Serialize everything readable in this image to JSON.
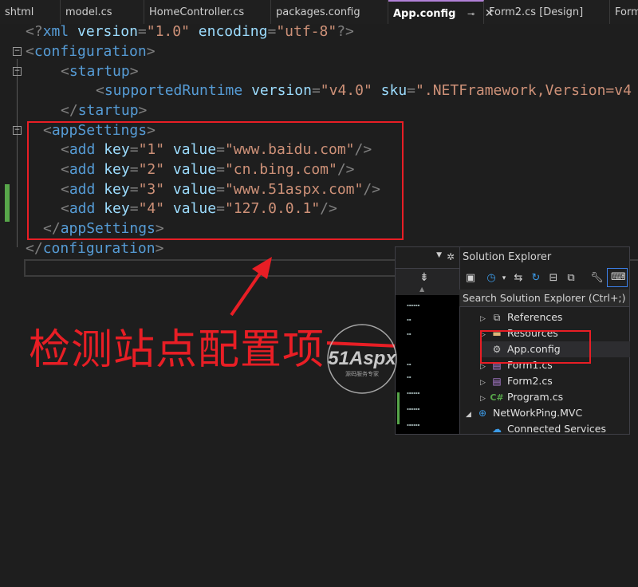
{
  "tabs": [
    {
      "label": "shtml",
      "active": false
    },
    {
      "label": "model.cs",
      "active": false
    },
    {
      "label": "HomeController.cs",
      "active": false
    },
    {
      "label": "packages.config",
      "active": false
    },
    {
      "label": "App.config",
      "active": true,
      "pin_icon": "pin-icon",
      "close_glyph": "✕"
    },
    {
      "label": "Form2.cs [Design]",
      "active": false
    },
    {
      "label": "Form",
      "active": false
    }
  ],
  "code": {
    "l1": {
      "open": "<?",
      "tag": "xml",
      "a1": "version",
      "v1": "\"1.0\"",
      "a2": "encoding",
      "v2": "\"utf-8\"",
      "close": "?>"
    },
    "l2": {
      "open": "<",
      "tag": "configuration",
      "close": ">"
    },
    "l3": {
      "open": "<",
      "tag": "startup",
      "close": ">"
    },
    "l4": {
      "open": "<",
      "tag": "supportedRuntime",
      "a1": "version",
      "v1": "\"v4.0\"",
      "a2": "sku",
      "v2": "\".NETFramework,Version=v4"
    },
    "l5": {
      "open": "</",
      "tag": "startup",
      "close": ">"
    },
    "l6": {
      "open": "<",
      "tag": "appSettings",
      "close": ">"
    },
    "adds": [
      {
        "open": "<",
        "tag": "add",
        "a1": "key",
        "v1": "\"1\"",
        "a2": "value",
        "v2": "\"www.baidu.com\"",
        "close": "/>"
      },
      {
        "open": "<",
        "tag": "add",
        "a1": "key",
        "v1": "\"2\"",
        "a2": "value",
        "v2": "\"cn.bing.com\"",
        "close": "/>"
      },
      {
        "open": "<",
        "tag": "add",
        "a1": "key",
        "v1": "\"3\"",
        "a2": "value",
        "v2": "\"www.51aspx.com\"",
        "close": "/>"
      },
      {
        "open": "<",
        "tag": "add",
        "a1": "key",
        "v1": "\"4\"",
        "a2": "value",
        "v2": "\"127.0.0.1\"",
        "close": "/>"
      }
    ],
    "l11": {
      "open": "</",
      "tag": "appSettings",
      "close": ">"
    },
    "l12": {
      "open": "</",
      "tag": "configuration",
      "close": ">"
    },
    "eq": "=",
    "fold_glyph": "−"
  },
  "annotation": {
    "text": "检测站点配置项",
    "color": "#e81e25"
  },
  "solution_explorer": {
    "title": "Solution Explorer",
    "search_placeholder": "Search Solution Explorer (Ctrl+;)",
    "toolbar_icons": [
      "vs-icon",
      "history-icon",
      "sync-icon",
      "refresh-icon",
      "collapse-icon",
      "copy-icon",
      "wrench-icon",
      "preview-icon"
    ],
    "items": [
      {
        "label": "References",
        "icon": "references-icon",
        "expander": "▷"
      },
      {
        "label": "Resources",
        "icon": "folder-icon",
        "expander": "▷"
      },
      {
        "label": "App.config",
        "icon": "config-file-icon",
        "expander": ""
      },
      {
        "label": "Form1.cs",
        "icon": "form-icon",
        "expander": "▷"
      },
      {
        "label": "Form2.cs",
        "icon": "form-icon",
        "expander": "▷"
      },
      {
        "label": "Program.cs",
        "icon": "csharp-file-icon",
        "expander": "▷",
        "glyph": "C#"
      },
      {
        "label": "NetWorkPing.MVC",
        "icon": "web-project-icon",
        "expander": "◢"
      },
      {
        "label": "Connected Services",
        "icon": "connected-services-icon",
        "expander": ""
      }
    ]
  },
  "logo": {
    "text": "51Aspx",
    "subtext": "源码服务专家",
    "icon": "51aspx-logo"
  },
  "colors": {
    "accent": "#b180d7",
    "annotation_red": "#e81e25",
    "tag_blue": "#569cd6",
    "attr": "#9cdcfe",
    "string": "#ce9178"
  }
}
